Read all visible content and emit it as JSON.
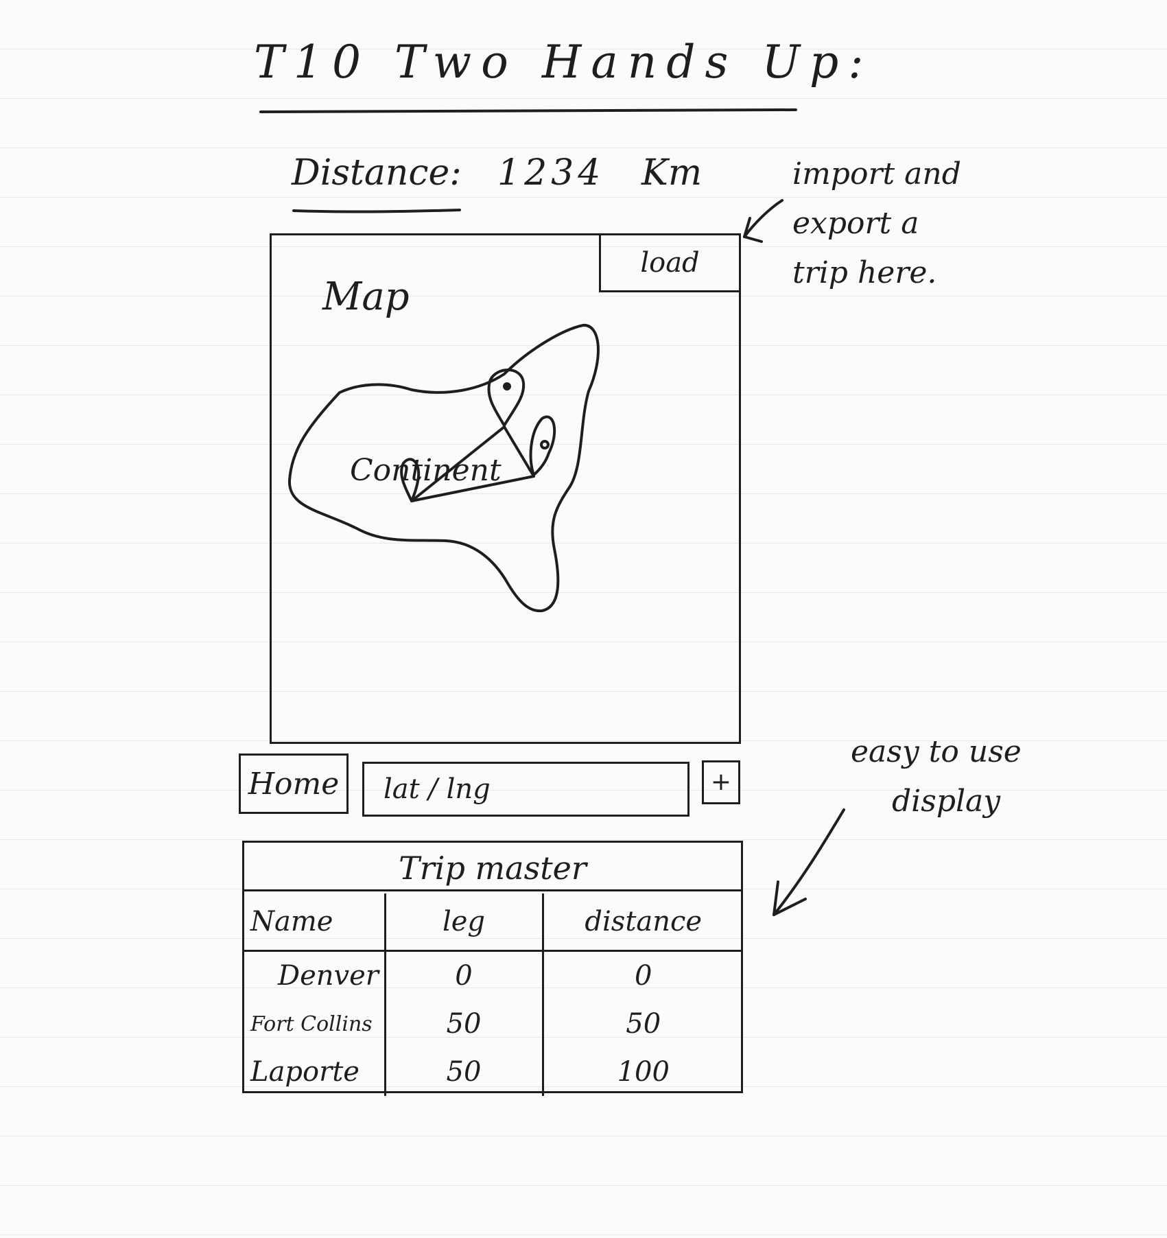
{
  "title": "T10 Two Hands Up:",
  "distance": {
    "label": "Distance:",
    "value": "1234",
    "unit": "Km"
  },
  "annotations": {
    "import_export": [
      "import and",
      "export a",
      "trip here."
    ],
    "table_display": [
      "easy to use",
      "display"
    ]
  },
  "map": {
    "label": "Map",
    "region_label": "Continent",
    "load_button": "load"
  },
  "controls": {
    "home_button": "Home",
    "latlng_placeholder": "lat / lng",
    "add_button": "+"
  },
  "trip": {
    "title": "Trip master",
    "columns": [
      "Name",
      "leg",
      "distance"
    ],
    "rows": [
      {
        "name": "Denver",
        "leg": "0",
        "distance": "0"
      },
      {
        "name": "Fort Collins",
        "leg": "50",
        "distance": "50"
      },
      {
        "name": "Laporte",
        "leg": "50",
        "distance": "100"
      }
    ]
  },
  "colors": {
    "ink": "#1e1e1e",
    "paper": "#fbfbfa",
    "rule_lines": "#e8e8e6"
  },
  "icons": [
    "arrow-icon",
    "map-pin-icon"
  ]
}
